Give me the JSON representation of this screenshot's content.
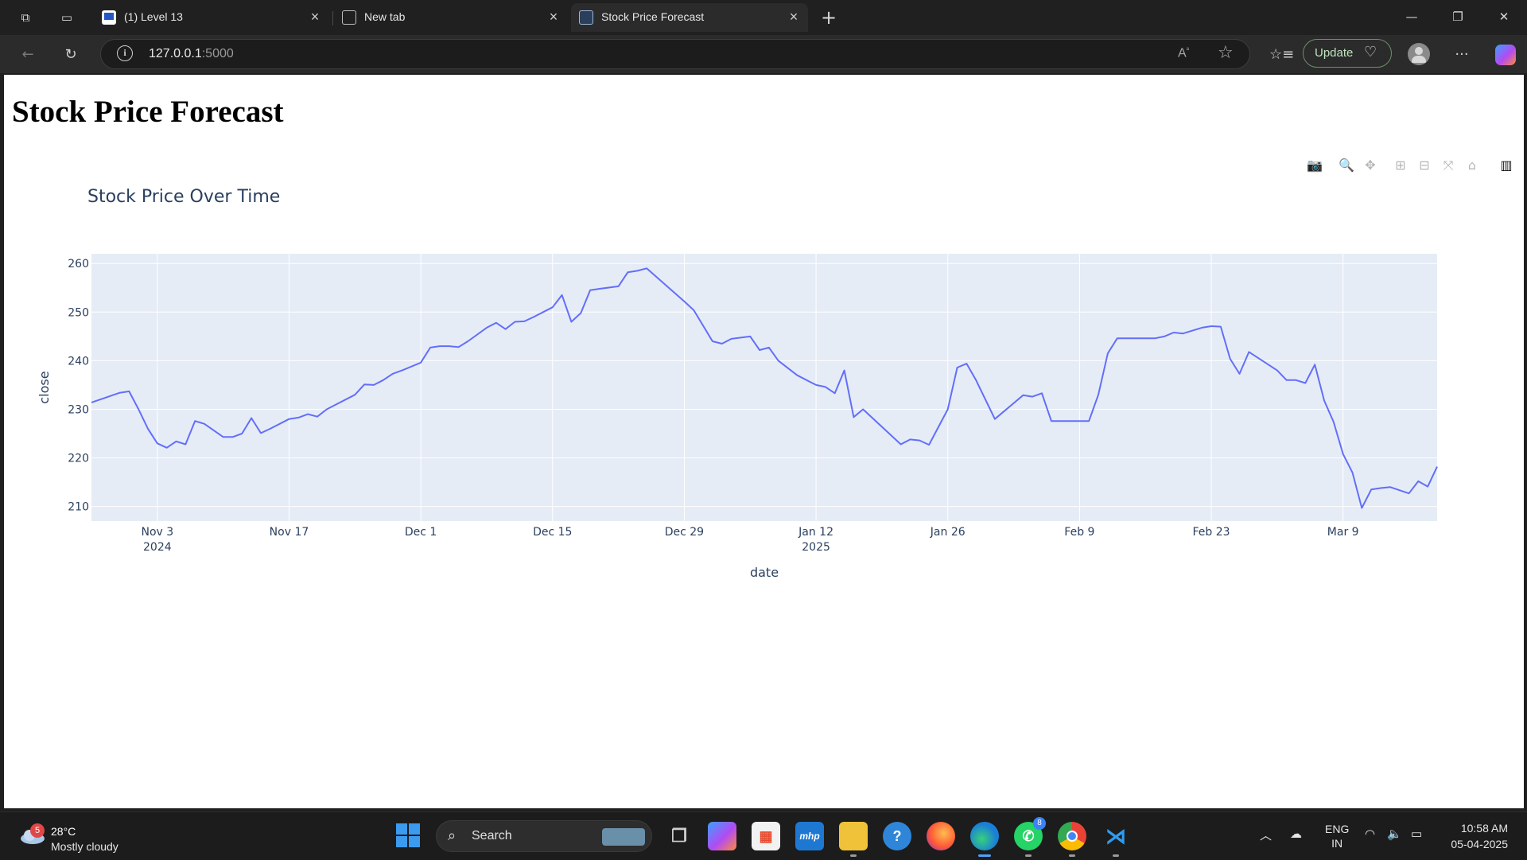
{
  "browser": {
    "tabs": [
      {
        "title": "(1) Level 13",
        "favicon": "level-favicon",
        "active": false
      },
      {
        "title": "New tab",
        "favicon": "newtab-icon",
        "active": false
      },
      {
        "title": "Stock Price Forecast",
        "favicon": "page-favicon",
        "active": true
      }
    ],
    "url_host": "127.0.0.1",
    "url_port": ":5000",
    "update_label": "Update"
  },
  "page": {
    "heading": "Stock Price Forecast"
  },
  "chart_data": {
    "type": "line",
    "title": "Stock Price Over Time",
    "xlabel": "date",
    "ylabel": "close",
    "line_color": "#636efa",
    "plot_bg": "#e5ecf6",
    "grid": true,
    "ylim": [
      207,
      262
    ],
    "xlim": [
      "2024-10-27",
      "2025-03-19"
    ],
    "y_ticks": [
      210,
      220,
      230,
      240,
      250,
      260
    ],
    "x_ticks": [
      {
        "date": "2024-11-03",
        "label": "Nov 3",
        "sub": "2024"
      },
      {
        "date": "2024-11-17",
        "label": "Nov 17",
        "sub": ""
      },
      {
        "date": "2024-12-01",
        "label": "Dec 1",
        "sub": ""
      },
      {
        "date": "2024-12-15",
        "label": "Dec 15",
        "sub": ""
      },
      {
        "date": "2024-12-29",
        "label": "Dec 29",
        "sub": ""
      },
      {
        "date": "2025-01-12",
        "label": "Jan 12",
        "sub": "2025"
      },
      {
        "date": "2025-01-26",
        "label": "Jan 26",
        "sub": ""
      },
      {
        "date": "2025-02-09",
        "label": "Feb 9",
        "sub": ""
      },
      {
        "date": "2025-02-23",
        "label": "Feb 23",
        "sub": ""
      },
      {
        "date": "2025-03-09",
        "label": "Mar 9",
        "sub": ""
      }
    ],
    "series": [
      {
        "x": [
          "2024-10-27",
          "2024-10-30",
          "2024-10-31",
          "2024-11-01",
          "2024-11-02",
          "2024-11-03",
          "2024-11-04",
          "2024-11-05",
          "2024-11-06",
          "2024-11-07",
          "2024-11-08",
          "2024-11-10",
          "2024-11-11",
          "2024-11-12",
          "2024-11-13",
          "2024-11-14",
          "2024-11-15",
          "2024-11-17",
          "2024-11-18",
          "2024-11-19",
          "2024-11-20",
          "2024-11-21",
          "2024-11-22",
          "2024-11-24",
          "2024-11-25",
          "2024-11-26",
          "2024-11-27",
          "2024-11-28",
          "2024-11-29",
          "2024-12-01",
          "2024-12-02",
          "2024-12-03",
          "2024-12-04",
          "2024-12-05",
          "2024-12-06",
          "2024-12-08",
          "2024-12-09",
          "2024-12-10",
          "2024-12-11",
          "2024-12-12",
          "2024-12-13",
          "2024-12-15",
          "2024-12-16",
          "2024-12-17",
          "2024-12-18",
          "2024-12-19",
          "2024-12-20",
          "2024-12-22",
          "2024-12-23",
          "2024-12-24",
          "2024-12-25",
          "2024-12-27",
          "2024-12-29",
          "2024-12-30",
          "2024-12-31",
          "2025-01-01",
          "2025-01-02",
          "2025-01-03",
          "2025-01-05",
          "2025-01-06",
          "2025-01-07",
          "2025-01-08",
          "2025-01-10",
          "2025-01-12",
          "2025-01-13",
          "2025-01-14",
          "2025-01-15",
          "2025-01-16",
          "2025-01-17",
          "2025-01-21",
          "2025-01-22",
          "2025-01-23",
          "2025-01-24",
          "2025-01-26",
          "2025-01-27",
          "2025-01-28",
          "2025-01-29",
          "2025-01-31",
          "2025-02-03",
          "2025-02-04",
          "2025-02-05",
          "2025-02-06",
          "2025-02-07",
          "2025-02-10",
          "2025-02-11",
          "2025-02-12",
          "2025-02-13",
          "2025-02-14",
          "2025-02-17",
          "2025-02-18",
          "2025-02-19",
          "2025-02-20",
          "2025-02-22",
          "2025-02-23",
          "2025-02-24",
          "2025-02-25",
          "2025-02-26",
          "2025-02-27",
          "2025-03-02",
          "2025-03-03",
          "2025-03-04",
          "2025-03-05",
          "2025-03-06",
          "2025-03-07",
          "2025-03-08",
          "2025-03-09",
          "2025-03-10",
          "2025-03-11",
          "2025-03-12",
          "2025-03-13",
          "2025-03-14",
          "2025-03-16",
          "2025-03-17",
          "2025-03-18",
          "2025-03-19"
        ],
        "y": [
          231.4,
          233.4,
          233.7,
          230.0,
          226.0,
          223.0,
          222.1,
          223.4,
          222.8,
          227.6,
          227.0,
          224.3,
          224.3,
          225.0,
          228.2,
          225.1,
          226.0,
          228.0,
          228.3,
          229.0,
          228.5,
          230.0,
          231.0,
          233.0,
          235.1,
          235.0,
          236.0,
          237.3,
          238.0,
          239.6,
          242.7,
          243.0,
          243.0,
          242.8,
          244.0,
          246.8,
          247.8,
          246.5,
          248.0,
          248.1,
          249.0,
          251.0,
          253.5,
          248.0,
          249.8,
          254.5,
          254.8,
          255.3,
          258.2,
          258.5,
          259.0,
          255.6,
          252.2,
          250.4,
          247.2,
          244.0,
          243.5,
          244.5,
          245.0,
          242.2,
          242.7,
          240.0,
          237.0,
          235.0,
          234.6,
          233.3,
          238.0,
          228.4,
          230.0,
          222.8,
          223.8,
          223.6,
          222.7,
          230.0,
          238.6,
          239.4,
          236.0,
          228.0,
          232.9,
          232.6,
          233.3,
          227.6,
          227.6,
          227.6,
          233.0,
          241.5,
          244.6,
          244.6,
          244.6,
          245.0,
          245.8,
          245.6,
          246.8,
          247.1,
          247.0,
          240.4,
          237.3,
          241.8,
          238.0,
          236.0,
          236.0,
          235.4,
          239.2,
          231.8,
          227.4,
          220.8,
          217.0,
          209.7,
          213.5,
          213.8,
          214.0,
          212.7,
          215.2,
          214.1,
          218.2
        ],
        "name": ""
      }
    ]
  },
  "taskbar": {
    "weather_badge": "5",
    "temperature": "28°C",
    "condition": "Mostly cloudy",
    "search_label": "Search",
    "apps": [
      "task-view",
      "copilot",
      "store",
      "mhp",
      "files",
      "help",
      "firefox",
      "edge",
      "whatsapp",
      "chrome",
      "vscode"
    ],
    "whatsapp_count": "8",
    "lang_line1": "ENG",
    "lang_line2": "IN",
    "time": "10:58 AM",
    "date": "05-04-2025"
  }
}
